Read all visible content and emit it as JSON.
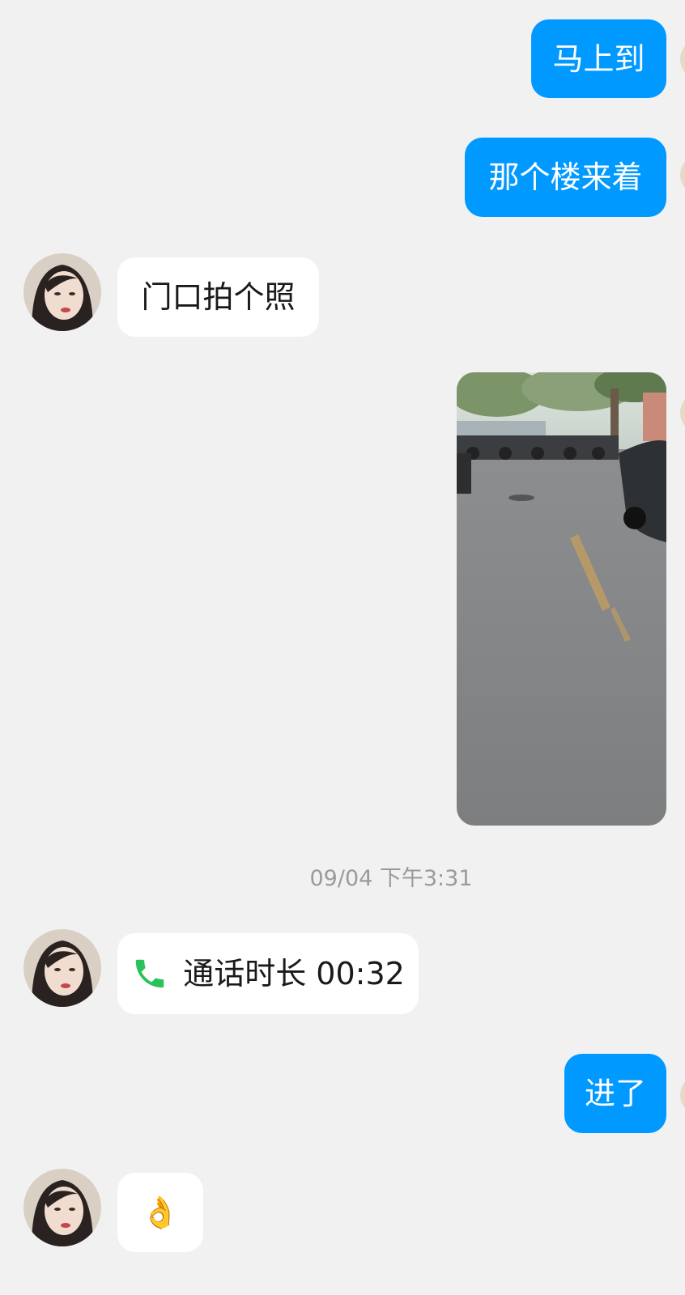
{
  "messages": {
    "m1": {
      "direction": "outgoing",
      "text": "马上到"
    },
    "m2": {
      "direction": "outgoing",
      "text": "那个楼来着"
    },
    "m3": {
      "direction": "incoming",
      "text": "门口拍个照"
    },
    "m4": {
      "direction": "outgoing",
      "type": "image",
      "subject": "street-photo"
    },
    "timestamp": "09/04 下午3:31",
    "m5": {
      "direction": "incoming",
      "type": "call",
      "icon": "phone-icon",
      "text": "通话时长 00:32"
    },
    "m6": {
      "direction": "outgoing",
      "text": "进了"
    },
    "m7": {
      "direction": "incoming",
      "text": "👌"
    }
  },
  "colors": {
    "background": "#f1f1f1",
    "outgoing_bubble": "#0099ff",
    "incoming_bubble": "#ffffff",
    "call_icon": "#2ac25a",
    "timestamp_text": "#9a9a9a"
  }
}
